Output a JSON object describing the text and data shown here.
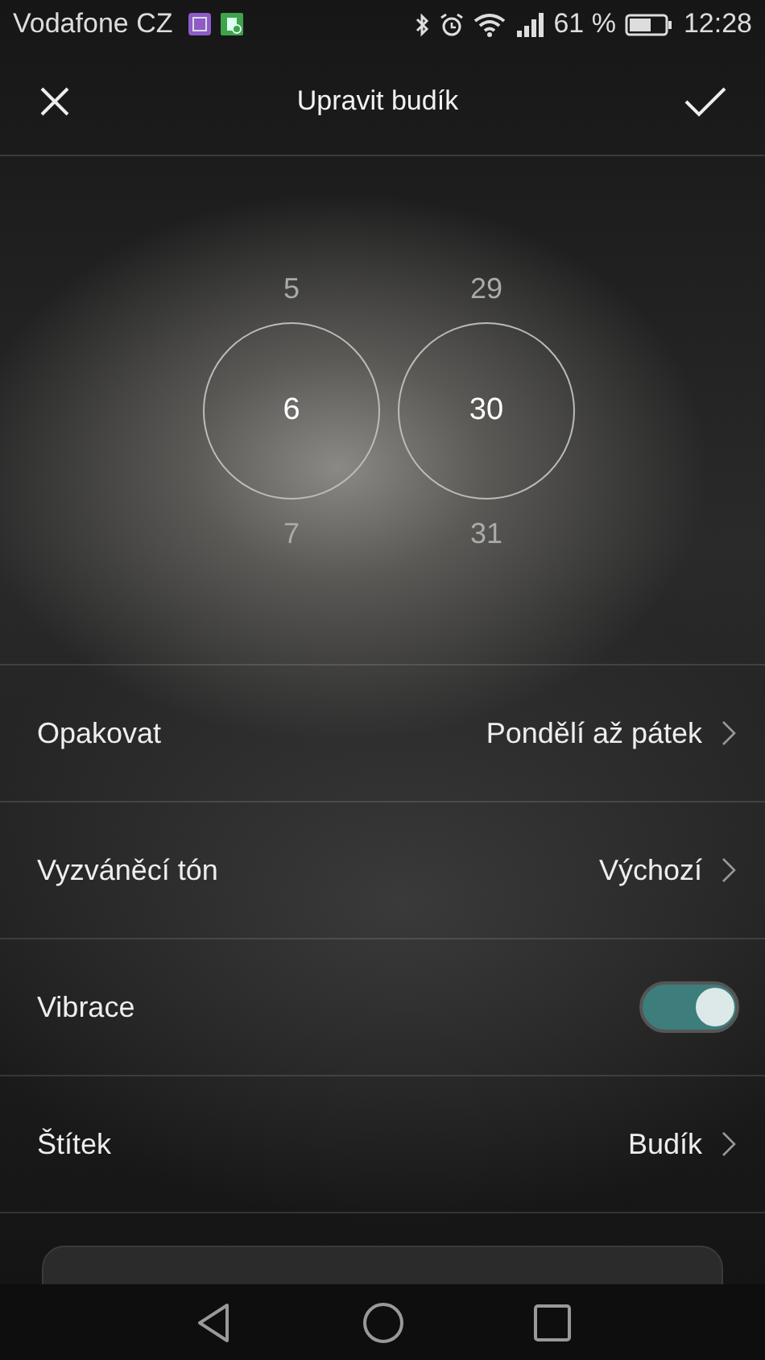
{
  "status_bar": {
    "carrier": "Vodafone CZ",
    "battery": "61 %",
    "time": "12:28"
  },
  "toolbar": {
    "title": "Upravit budík"
  },
  "picker": [
    {
      "above": "5",
      "value": "6",
      "below": "7"
    },
    {
      "above": "29",
      "value": "30",
      "below": "31"
    }
  ],
  "settings": [
    {
      "kind": "link",
      "label": "Opakovat",
      "value": "Pondělí až pátek"
    },
    {
      "kind": "link",
      "label": "Vyzváněcí tón",
      "value": "Výchozí"
    },
    {
      "kind": "toggle",
      "label": "Vibrace",
      "on": true
    },
    {
      "kind": "link",
      "label": "Štítek",
      "value": "Budík"
    }
  ]
}
